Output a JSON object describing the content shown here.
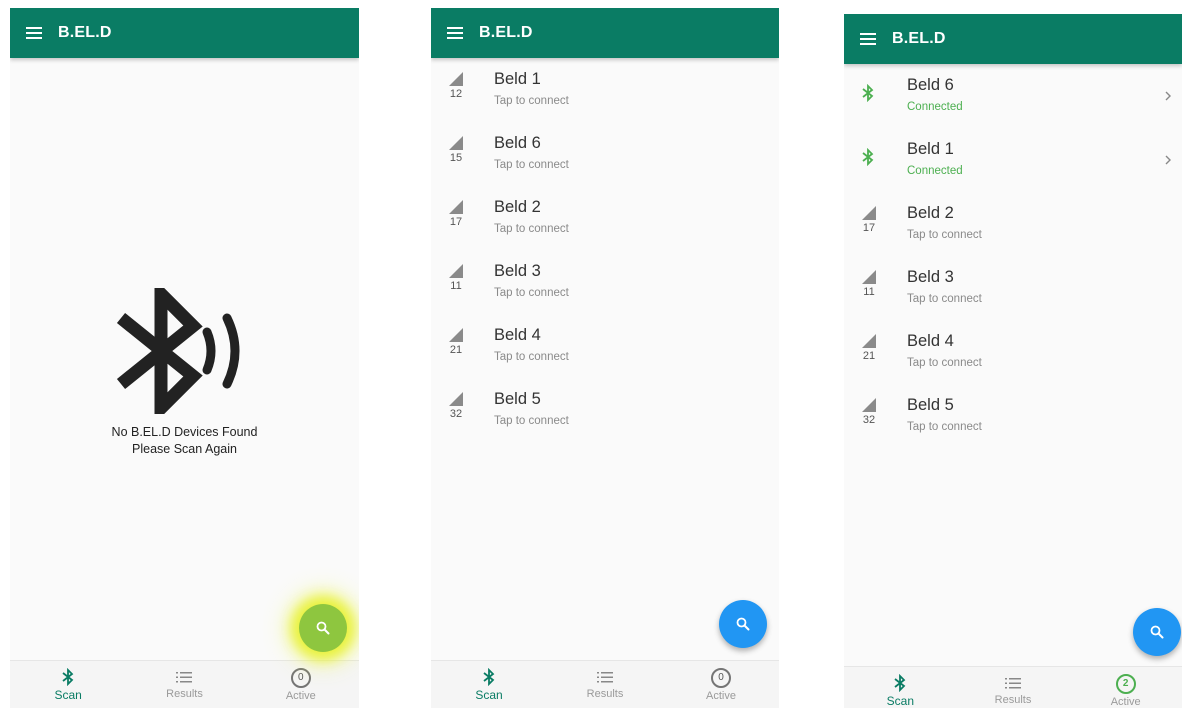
{
  "app": {
    "title": "B.EL.D"
  },
  "colors": {
    "primary": "#0a7c64",
    "connected": "#4caf50",
    "fab": "#2196f3",
    "fab_highlight": "#8ec63f"
  },
  "nav": {
    "scan": "Scan",
    "results": "Results",
    "active": "Active"
  },
  "screen1": {
    "empty_line1": "No B.EL.D Devices Found",
    "empty_line2": "Please Scan Again",
    "active_count": "0"
  },
  "screen2": {
    "active_count": "0",
    "devices": [
      {
        "name": "Beld 1",
        "status": "Tap to connect",
        "signal": "12",
        "icon": "signal-icon"
      },
      {
        "name": "Beld 6",
        "status": "Tap to connect",
        "signal": "15",
        "icon": "signal-icon"
      },
      {
        "name": "Beld 2",
        "status": "Tap to connect",
        "signal": "17",
        "icon": "signal-icon"
      },
      {
        "name": "Beld 3",
        "status": "Tap to connect",
        "signal": "11",
        "icon": "signal-icon"
      },
      {
        "name": "Beld 4",
        "status": "Tap to connect",
        "signal": "21",
        "icon": "signal-icon"
      },
      {
        "name": "Beld 5",
        "status": "Tap to connect",
        "signal": "32",
        "icon": "signal-icon"
      }
    ]
  },
  "screen3": {
    "active_count": "2",
    "devices": [
      {
        "name": "Beld 6",
        "status": "Connected",
        "icon": "bluetooth-icon"
      },
      {
        "name": "Beld 1",
        "status": "Connected",
        "icon": "bluetooth-icon"
      },
      {
        "name": "Beld 2",
        "status": "Tap to connect",
        "signal": "17",
        "icon": "signal-icon"
      },
      {
        "name": "Beld 3",
        "status": "Tap to connect",
        "signal": "11",
        "icon": "signal-icon"
      },
      {
        "name": "Beld 4",
        "status": "Tap to connect",
        "signal": "21",
        "icon": "signal-icon"
      },
      {
        "name": "Beld 5",
        "status": "Tap to connect",
        "signal": "32",
        "icon": "signal-icon"
      }
    ]
  }
}
